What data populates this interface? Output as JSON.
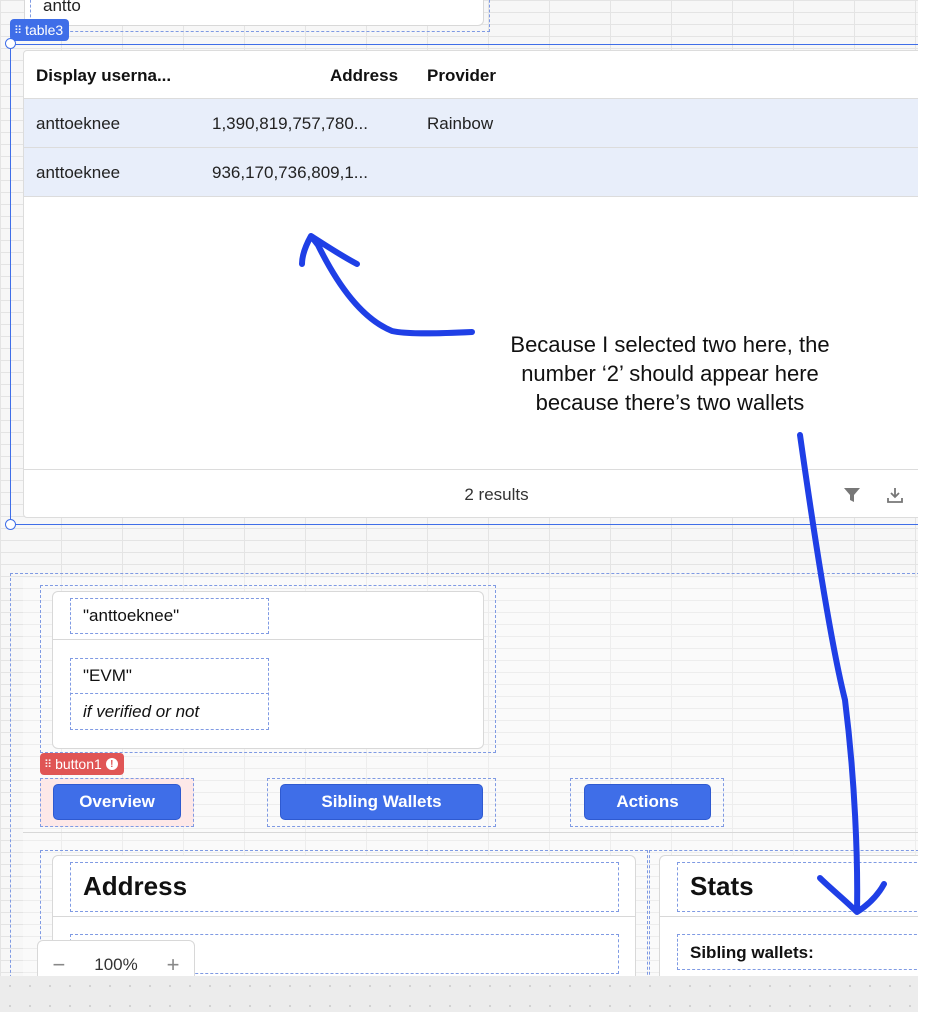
{
  "top_stub": {
    "text": "antto"
  },
  "table_tag": {
    "label": "table3"
  },
  "table": {
    "columns": [
      "Display userna...",
      "Address",
      "Provider"
    ],
    "rows": [
      {
        "username": "anttoeknee",
        "address": "1,390,819,757,780...",
        "provider": "Rainbow"
      },
      {
        "username": "anttoeknee",
        "address": "936,170,736,809,1...",
        "provider": ""
      }
    ],
    "footer": {
      "results": "2 results",
      "filter_icon": "filter-icon",
      "download_icon": "download-icon"
    }
  },
  "profile": {
    "username": "\"anttoeknee\"",
    "chain": "\"EVM\"",
    "verified": "if verified or not"
  },
  "button_tag": {
    "label": "button1"
  },
  "buttons": {
    "overview": "Overview",
    "sibling_wallets": "Sibling Wallets",
    "actions": "Actions"
  },
  "address_panel": {
    "title": "Address"
  },
  "stats_panel": {
    "title": "Stats",
    "sibling_label": "Sibling wallets:"
  },
  "zoom": {
    "minus": "−",
    "value": "100%",
    "plus": "+"
  },
  "annotation": {
    "line1": "Because I selected two here, the",
    "line2": "number ‘2’ should appear here",
    "line3": "because there’s two wallets"
  },
  "colors": {
    "accent": "#3f6ee8",
    "error": "#e05555",
    "annotation": "#1f3fe6",
    "row_selected": "#e8eefa"
  }
}
